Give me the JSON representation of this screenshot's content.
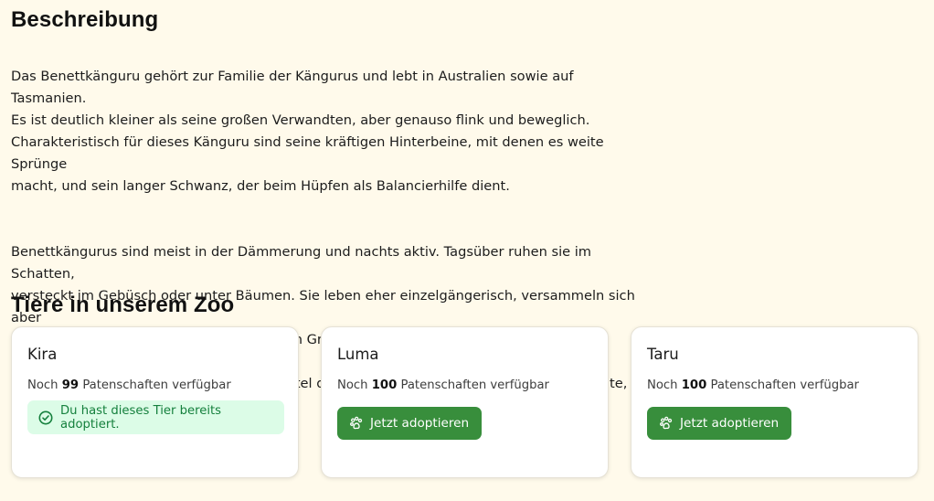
{
  "description": {
    "title": "Beschreibung",
    "paragraph1": "Das Benettkänguru gehört zur Familie der Kängurus und lebt in Australien sowie auf Tasmanien.\nEs ist deutlich kleiner als seine großen Verwandten, aber genauso flink und beweglich.\nCharakteristisch für dieses Känguru sind seine kräftigen Hinterbeine, mit denen es weite Sprünge\nmacht, und sein langer Schwanz, der beim Hüpfen als Balancierhilfe dient.",
    "paragraph2": "Benettkängurus sind meist in der Dämmerung und nachts aktiv. Tagsüber ruhen sie im Schatten,\nversteckt im Gebüsch oder unter Bäumen. Sie leben eher einzelgängerisch, versammeln sich aber\nmanchmal an guten Futterstellen in kleinen Gruppen. Besonders spannend ist ihre Fortpflanzung:\nDas winzige Jungtier wächst zuerst im Beutel der Mutter heran und bleibt dort viele Monate,\nbevor es die Welt erkundet."
  },
  "zoo": {
    "title": "Tiere in unserem Zoo",
    "count_prefix": "Noch",
    "count_suffix": "Patenschaften verfügbar",
    "adopted_message": "Du hast dieses Tier bereits adoptiert.",
    "adopt_button_label": "Jetzt adoptieren",
    "animals": [
      {
        "name": "Kira",
        "count": "99",
        "adopted": true
      },
      {
        "name": "Luma",
        "count": "100",
        "adopted": false
      },
      {
        "name": "Taru",
        "count": "100",
        "adopted": false
      }
    ]
  },
  "colors": {
    "background": "#fffaeb",
    "button": "#388e3c",
    "adopted_bg": "#dcfce7",
    "adopted_text": "#15803d"
  },
  "icons": {
    "adopted": "check-circle-icon",
    "adopt_button": "paw-icon"
  }
}
